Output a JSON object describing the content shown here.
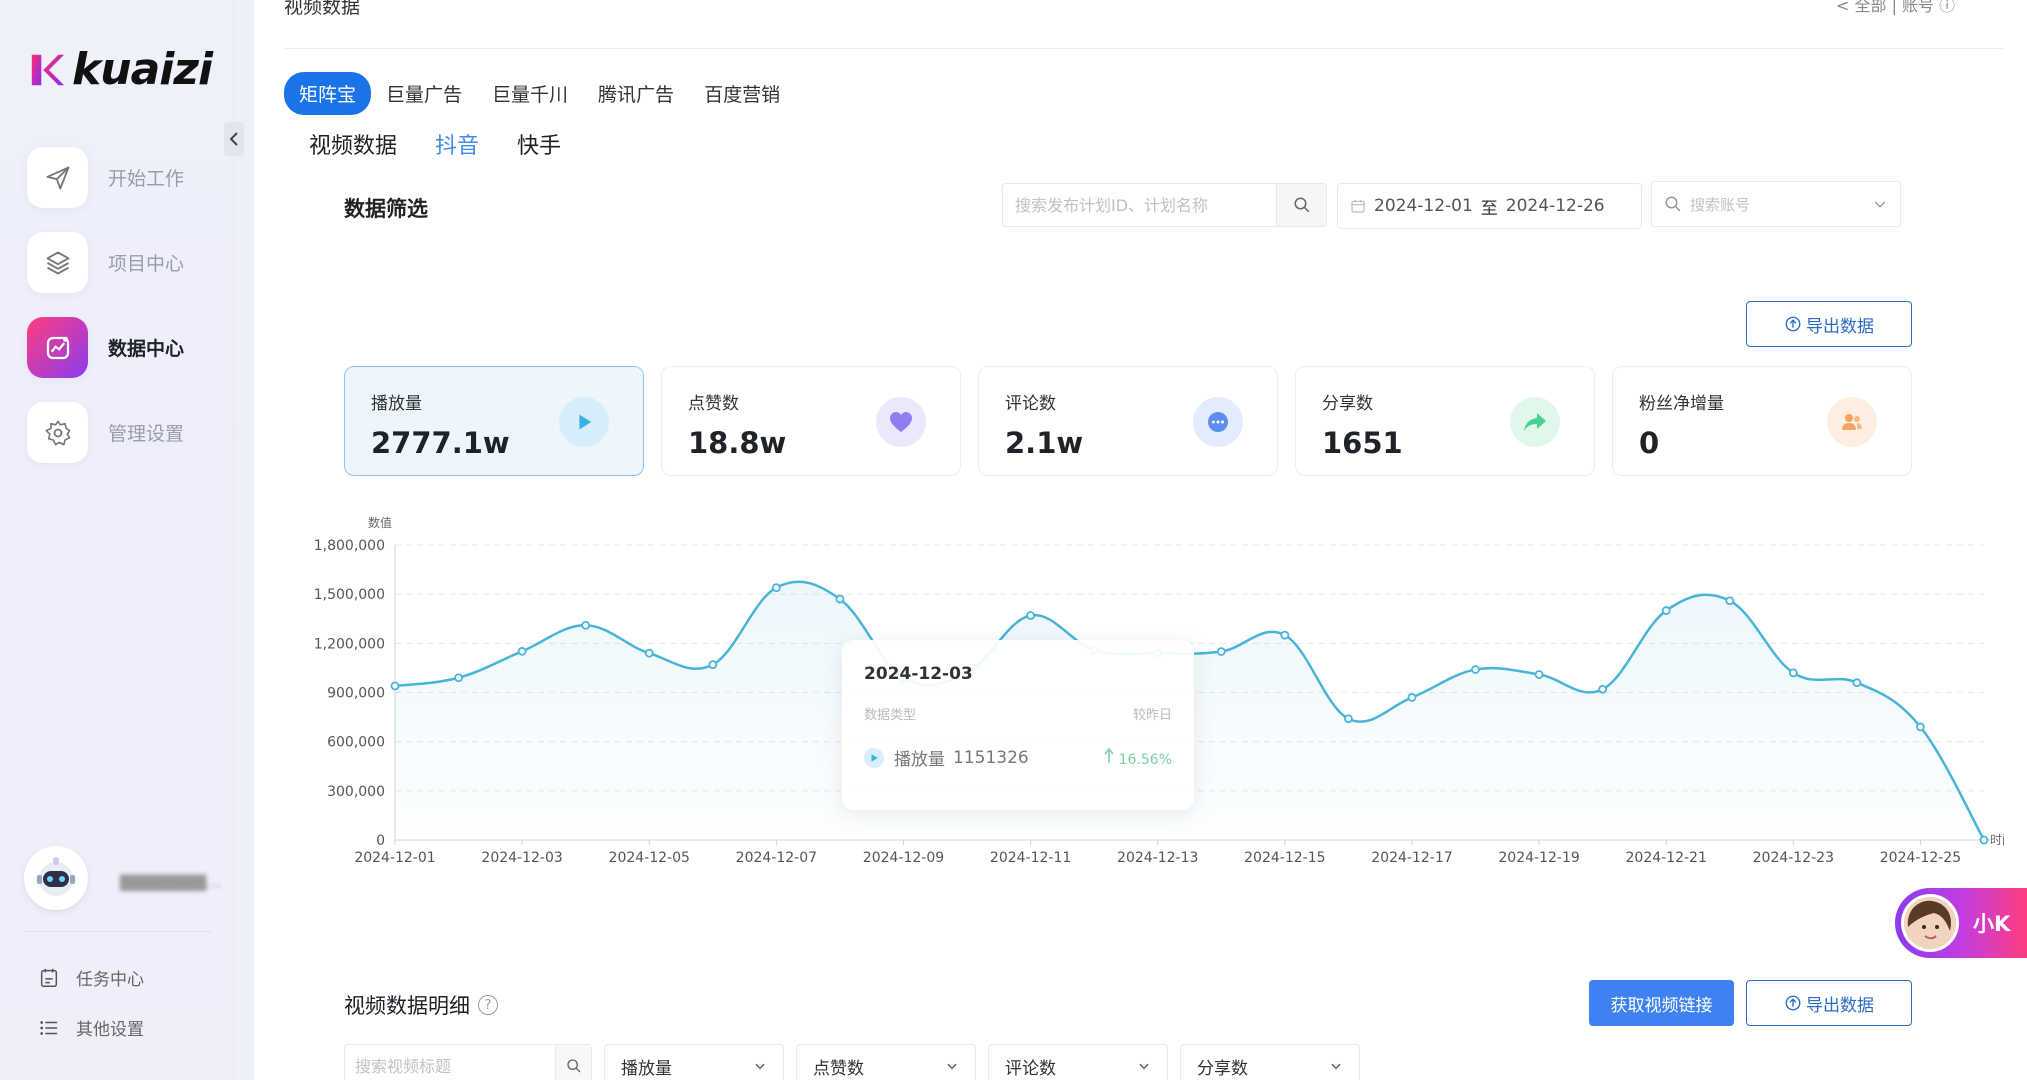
{
  "brand": {
    "name": "kuaizi"
  },
  "sidebar": {
    "items": [
      {
        "label": "开始工作",
        "icon": "send-icon"
      },
      {
        "label": "项目中心",
        "icon": "layers-icon"
      },
      {
        "label": "数据中心",
        "icon": "chart-icon",
        "active": true
      },
      {
        "label": "管理设置",
        "icon": "gear-icon"
      }
    ],
    "user_name": "▇▇▇▇▇▇▇...",
    "bottom_links": [
      {
        "label": "任务中心",
        "icon": "task-icon"
      },
      {
        "label": "其他设置",
        "icon": "list-icon"
      }
    ]
  },
  "header": {
    "title": "视频数据",
    "right_text": "< 全部 | 账号 ⓘ"
  },
  "platform_tabs": [
    "矩阵宝",
    "巨量广告",
    "巨量千川",
    "腾讯广告",
    "百度营销"
  ],
  "active_platform": "矩阵宝",
  "sub_tabs": [
    "视频数据",
    "抖音",
    "快手"
  ],
  "active_sub_tab": "抖音",
  "filter": {
    "title": "数据筛选",
    "search_placeholder": "搜索发布计划ID、计划名称",
    "date_start": "2024-12-01",
    "date_sep": "至",
    "date_end": "2024-12-26",
    "account_placeholder": "搜索账号"
  },
  "export_label": "导出数据",
  "stats": [
    {
      "label": "播放量",
      "value": "2777.1w",
      "icon": "play-icon",
      "color": "#3ab2e0",
      "bg": "#d6eef9",
      "active": true
    },
    {
      "label": "点赞数",
      "value": "18.8w",
      "icon": "heart-icon",
      "color": "#8f7ef2",
      "bg": "#ebe8fb"
    },
    {
      "label": "评论数",
      "value": "2.1w",
      "icon": "comment-icon",
      "color": "#5b8ef0",
      "bg": "#e3ecfc"
    },
    {
      "label": "分享数",
      "value": "1651",
      "icon": "share-icon",
      "color": "#4ccf8f",
      "bg": "#e2f7ec"
    },
    {
      "label": "粉丝净增量",
      "value": "0",
      "icon": "fans-icon",
      "color": "#f6a263",
      "bg": "#fdeee2"
    }
  ],
  "chart_data": {
    "type": "area",
    "ylabel": "数值",
    "xlabel": "时间",
    "ylim": [
      0,
      1800000
    ],
    "yticks": [
      0,
      300000,
      600000,
      900000,
      1200000,
      1500000,
      1800000
    ],
    "ytick_labels": [
      "0",
      "300,000",
      "600,000",
      "900,000",
      "1,200,000",
      "1,500,000",
      "1,800,000"
    ],
    "xtick_labels": [
      "2024-12-01",
      "2024-12-03",
      "2024-12-05",
      "2024-12-07",
      "2024-12-09",
      "2024-12-11",
      "2024-12-13",
      "2024-12-15",
      "2024-12-17",
      "2024-12-19",
      "2024-12-21",
      "2024-12-23",
      "2024-12-25"
    ],
    "x": [
      "2024-12-01",
      "2024-12-02",
      "2024-12-03",
      "2024-12-04",
      "2024-12-05",
      "2024-12-06",
      "2024-12-07",
      "2024-12-08",
      "2024-12-09",
      "2024-12-10",
      "2024-12-11",
      "2024-12-12",
      "2024-12-13",
      "2024-12-14",
      "2024-12-15",
      "2024-12-16",
      "2024-12-17",
      "2024-12-18",
      "2024-12-19",
      "2024-12-20",
      "2024-12-21",
      "2024-12-22",
      "2024-12-23",
      "2024-12-24",
      "2024-12-25",
      "2024-12-26"
    ],
    "series": [
      {
        "name": "播放量",
        "values": [
          940000,
          990000,
          1151326,
          1310000,
          1140000,
          1070000,
          1540000,
          1470000,
          990000,
          1020000,
          1370000,
          1160000,
          1140000,
          1150000,
          1250000,
          740000,
          870000,
          1040000,
          1010000,
          920000,
          1400000,
          1460000,
          1020000,
          960000,
          690000,
          0
        ],
        "color": "#4ab3d8"
      }
    ],
    "grid": true
  },
  "tooltip": {
    "date": "2024-12-03",
    "type_label": "数据类型",
    "compare_label": "较昨日",
    "metric": "播放量",
    "value": "1151326",
    "change": "16.56%"
  },
  "detail": {
    "title": "视频数据明细",
    "get_link_label": "获取视频链接",
    "search_placeholder": "搜索视频标题",
    "selects": [
      "播放量",
      "点赞数",
      "评论数",
      "分享数"
    ]
  },
  "assistant": {
    "label": "小K"
  }
}
